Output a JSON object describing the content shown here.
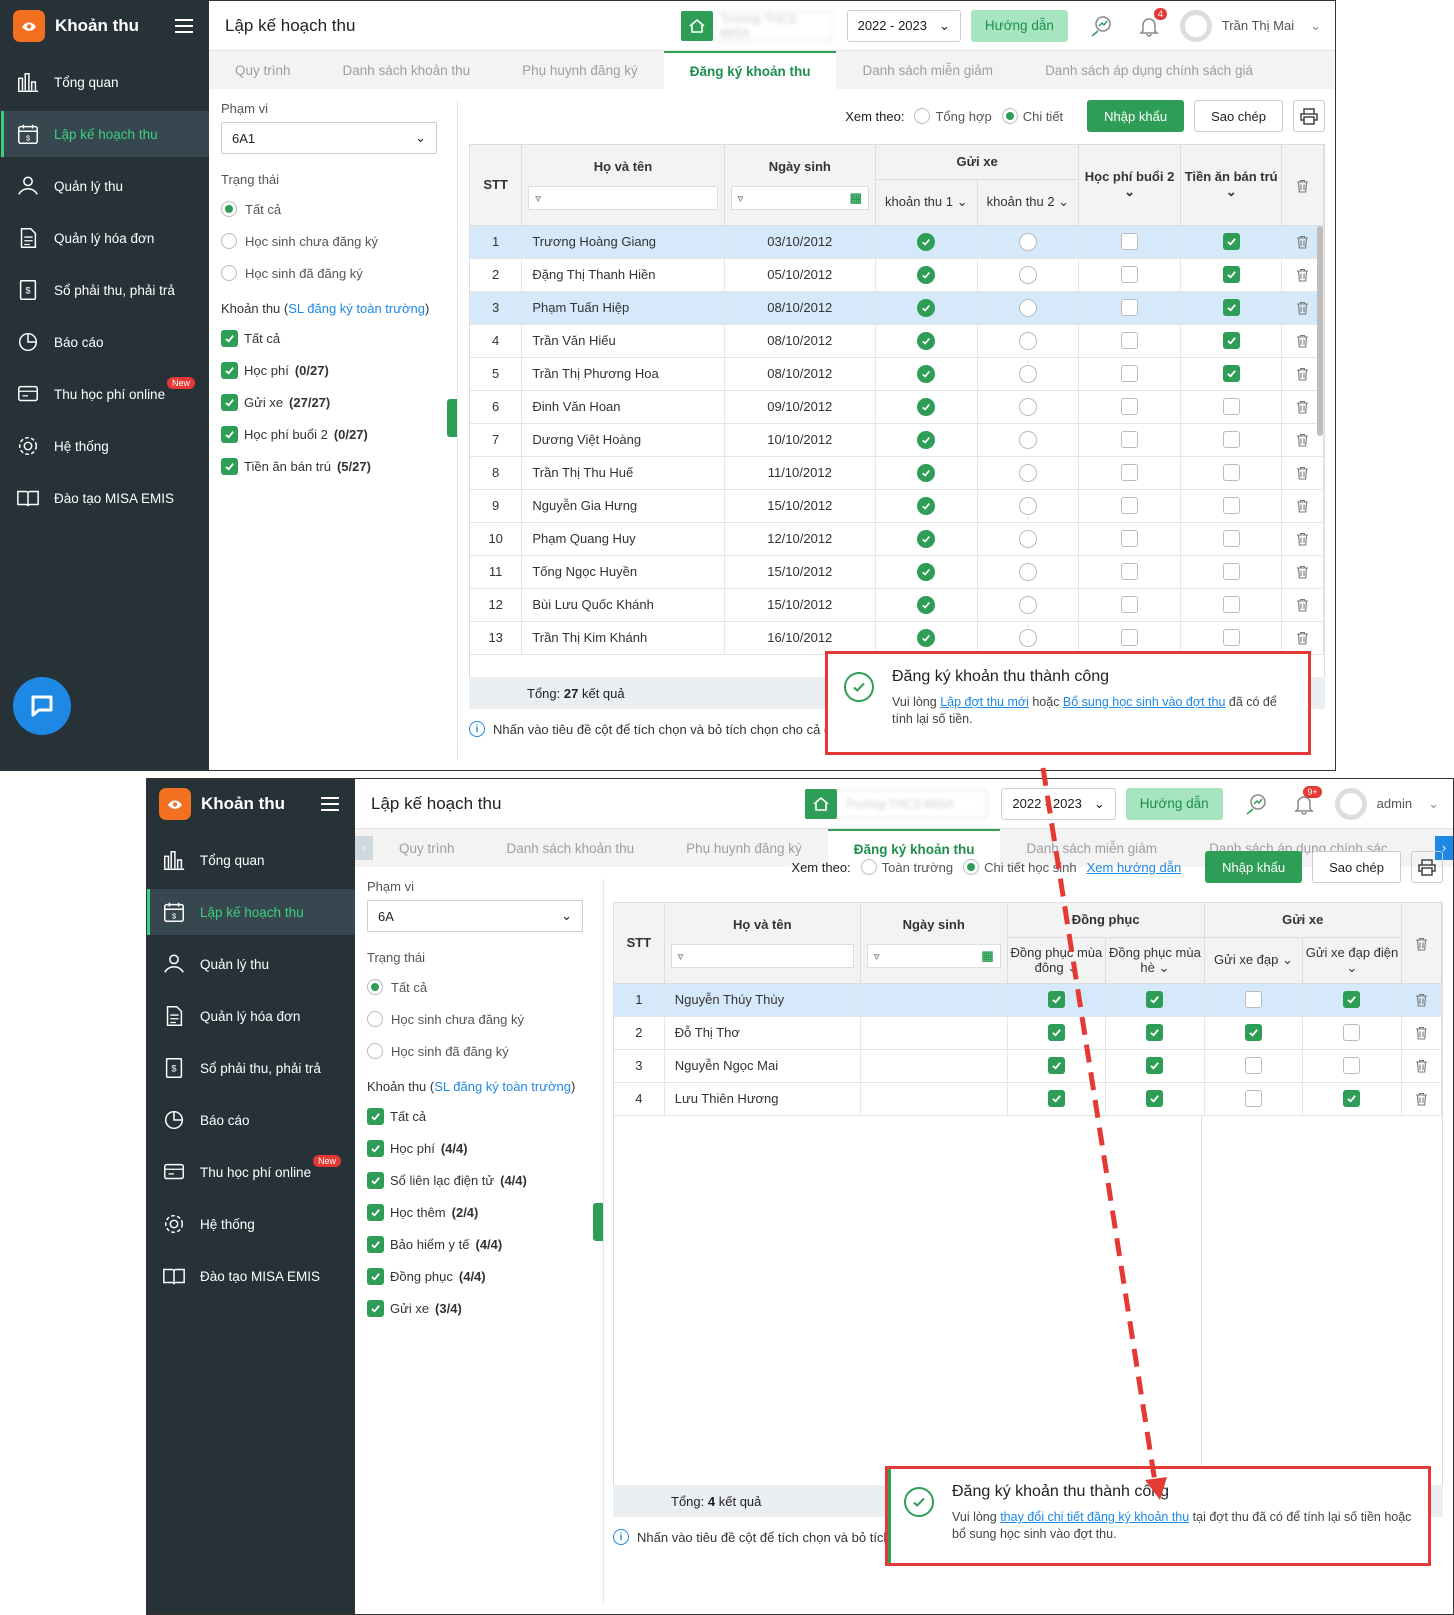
{
  "shots": [
    {
      "app_name": "Khoản thu",
      "page_title": "Lập kế hoạch thu",
      "school_name": "Trường THCS MISA",
      "year": "2022 - 2023",
      "guide": "Hướng dẫn",
      "notif_count": "4",
      "user": "Trần Thị Mai",
      "nav": [
        "Tổng quan",
        "Lập kế hoạch thu",
        "Quản lý thu",
        "Quản lý hóa đơn",
        "Sổ phải thu, phải trả",
        "Báo cáo",
        "Thu học phí online",
        "Hệ thống",
        "Đào tạo MISA EMIS"
      ],
      "nav_new_badge": "New",
      "tabs": [
        "Quy trình",
        "Danh sách khoản thu",
        "Phụ huynh đăng ký",
        "Đăng ký khoản thu",
        "Danh sách miễn giảm",
        "Danh sách áp dụng chính sách giá"
      ],
      "scope_label": "Phạm vi",
      "scope_value": "6A1",
      "status_label": "Trạng thái",
      "status_options": [
        "Tất cả",
        "Học sinh chưa đăng ký",
        "Học sinh đã đăng ký"
      ],
      "khoan_label": "Khoản thu (",
      "khoan_link": "SL đăng ký toàn trường",
      "khoan_close": ")",
      "fees": [
        {
          "name": "Tất cả",
          "count": ""
        },
        {
          "name": "Học phí",
          "count": "(0/27)"
        },
        {
          "name": "Gửi xe",
          "count": "(27/27)"
        },
        {
          "name": "Học phí buổi 2",
          "count": "(0/27)"
        },
        {
          "name": "Tiền ăn bán trú",
          "count": "(5/27)"
        }
      ],
      "view_label": "Xem theo:",
      "view_options": [
        "Tổng hợp",
        "Chi tiết"
      ],
      "guide_link": "",
      "btn_import": "Nhập khẩu",
      "btn_copy": "Sao chép",
      "col_stt": "STT",
      "col_name": "Họ và tên",
      "col_dob": "Ngày sinh",
      "group1": "Gửi xe",
      "sub1": [
        "khoản thu 1",
        "khoản thu 2"
      ],
      "group2": "",
      "sub2": [
        "Học phí buổi 2",
        "Tiền ăn bán trú"
      ],
      "rows": [
        {
          "stt": "1",
          "name": "Trương Hoàng Giang",
          "dob": "03/10/2012",
          "v": [
            1,
            0,
            0,
            1
          ],
          "sel": true
        },
        {
          "stt": "2",
          "name": "Đặng Thị Thanh Hiền",
          "dob": "05/10/2012",
          "v": [
            1,
            0,
            0,
            1
          ],
          "sel": false
        },
        {
          "stt": "3",
          "name": "Phạm Tuấn Hiệp",
          "dob": "08/10/2012",
          "v": [
            1,
            0,
            0,
            1
          ],
          "sel": true
        },
        {
          "stt": "4",
          "name": "Trần Văn Hiếu",
          "dob": "08/10/2012",
          "v": [
            1,
            0,
            0,
            1
          ],
          "sel": false
        },
        {
          "stt": "5",
          "name": "Trần Thị Phương Hoa",
          "dob": "08/10/2012",
          "v": [
            1,
            0,
            0,
            1
          ],
          "sel": false
        },
        {
          "stt": "6",
          "name": "Đinh Văn Hoan",
          "dob": "09/10/2012",
          "v": [
            1,
            0,
            0,
            0
          ],
          "sel": false
        },
        {
          "stt": "7",
          "name": "Dương Việt Hoàng",
          "dob": "10/10/2012",
          "v": [
            1,
            0,
            0,
            0
          ],
          "sel": false
        },
        {
          "stt": "8",
          "name": "Trần Thị Thu Huế",
          "dob": "11/10/2012",
          "v": [
            1,
            0,
            0,
            0
          ],
          "sel": false
        },
        {
          "stt": "9",
          "name": "Nguyễn Gia Hưng",
          "dob": "15/10/2012",
          "v": [
            1,
            0,
            0,
            0
          ],
          "sel": false
        },
        {
          "stt": "10",
          "name": "Phạm Quang Huy",
          "dob": "12/10/2012",
          "v": [
            1,
            0,
            0,
            0
          ],
          "sel": false
        },
        {
          "stt": "11",
          "name": "Tống Ngọc Huyền",
          "dob": "15/10/2012",
          "v": [
            1,
            0,
            0,
            0
          ],
          "sel": false
        },
        {
          "stt": "12",
          "name": "Bùi Lưu Quốc Khánh",
          "dob": "15/10/2012",
          "v": [
            1,
            0,
            0,
            0
          ],
          "sel": false
        },
        {
          "stt": "13",
          "name": "Trần Thị Kim Khánh",
          "dob": "16/10/2012",
          "v": [
            1,
            0,
            0,
            0
          ],
          "sel": false
        }
      ],
      "total_label": "Tổng:",
      "total_count": "27",
      "total_suffix": "kết quả",
      "hint": "Nhấn vào tiêu đề cột để tích chọn và bỏ tích chọn cho cả cột",
      "toast_title": "Đăng ký khoản thu thành công",
      "toast_pre": "Vui lòng ",
      "toast_link1": "Lập đợt thu mới",
      "toast_mid": " hoặc ",
      "toast_link2": "Bổ sung học sinh vào đợt thu",
      "toast_post": " đã có để tính lại số tiền."
    },
    {
      "app_name": "Khoản thu",
      "page_title": "Lập kế hoạch thu",
      "school_name": "Trường THCS MISA",
      "year": "2022 - 2023",
      "guide": "Hướng dẫn",
      "notif_count": "9+",
      "user": "admin",
      "nav": [
        "Tổng quan",
        "Lập kế hoạch thu",
        "Quản lý thu",
        "Quản lý hóa đơn",
        "Sổ phải thu, phải trả",
        "Báo cáo",
        "Thu học phí online",
        "Hệ thống",
        "Đào tạo MISA EMIS"
      ],
      "nav_new_badge": "New",
      "tabs": [
        "Quy trình",
        "Danh sách khoản thu",
        "Phụ huynh đăng ký",
        "Đăng ký khoản thu",
        "Danh sách miễn giảm",
        "Danh sách áp dụng chính sác"
      ],
      "scope_label": "Phạm vi",
      "scope_value": "6A",
      "status_label": "Trạng thái",
      "status_options": [
        "Tất cả",
        "Học sinh chưa đăng ký",
        "Học sinh đã đăng ký"
      ],
      "khoan_label": "Khoản thu (",
      "khoan_link": "SL đăng ký toàn trường",
      "khoan_close": ")",
      "fees": [
        {
          "name": "Tất cả",
          "count": ""
        },
        {
          "name": "Học phí",
          "count": "(4/4)"
        },
        {
          "name": "Sổ liên lạc điện tử",
          "count": "(4/4)"
        },
        {
          "name": "Học thêm",
          "count": "(2/4)"
        },
        {
          "name": "Bảo hiểm y tế",
          "count": "(4/4)"
        },
        {
          "name": "Đồng phục",
          "count": "(4/4)"
        },
        {
          "name": "Gửi xe",
          "count": "(3/4)"
        }
      ],
      "view_label": "Xem theo:",
      "view_options": [
        "Toàn trường",
        "Chi tiết học sinh"
      ],
      "guide_link": "Xem hướng dẫn",
      "btn_import": "Nhập khẩu",
      "btn_copy": "Sao chép",
      "col_stt": "STT",
      "col_name": "Họ và tên",
      "col_dob": "Ngày sinh",
      "group1": "Đồng phục",
      "sub1": [
        "Đồng phục mùa đông",
        "Đồng phục mùa hè"
      ],
      "group2": "Gửi xe",
      "sub2": [
        "Gửi xe đạp",
        "Gửi xe đạp điện"
      ],
      "rows": [
        {
          "stt": "1",
          "name": "Nguyễn Thúy Thùy",
          "dob": "",
          "v": [
            1,
            1,
            0,
            1
          ],
          "sel": true
        },
        {
          "stt": "2",
          "name": "Đỗ Thị Thơ",
          "dob": "",
          "v": [
            1,
            1,
            1,
            0
          ],
          "sel": false
        },
        {
          "stt": "3",
          "name": "Nguyễn Ngọc Mai",
          "dob": "",
          "v": [
            1,
            1,
            0,
            0
          ],
          "sel": false
        },
        {
          "stt": "4",
          "name": "Lưu Thiên Hương",
          "dob": "",
          "v": [
            1,
            1,
            0,
            1
          ],
          "sel": false
        }
      ],
      "total_label": "Tổng:",
      "total_count": "4",
      "total_suffix": "kết quả",
      "hint": "Nhấn vào tiêu đề cột để tích chọn và bỏ tích chọn cho cả cột",
      "toast_title": "Đăng ký khoản thu thành công",
      "toast_pre": "Vui lòng ",
      "toast_link1": "thay đổi chi tiết đăng ký khoản thu",
      "toast_mid": " tại đợt thu đã có để tính lại số tiền hoặc bổ sung học sinh vào đợt thu.",
      "toast_link2": "",
      "toast_post": ""
    }
  ],
  "colors": {
    "sidebar": "#263238",
    "accent": "#2e9e57",
    "highlight": "#e53935",
    "link": "#1e88e5"
  }
}
